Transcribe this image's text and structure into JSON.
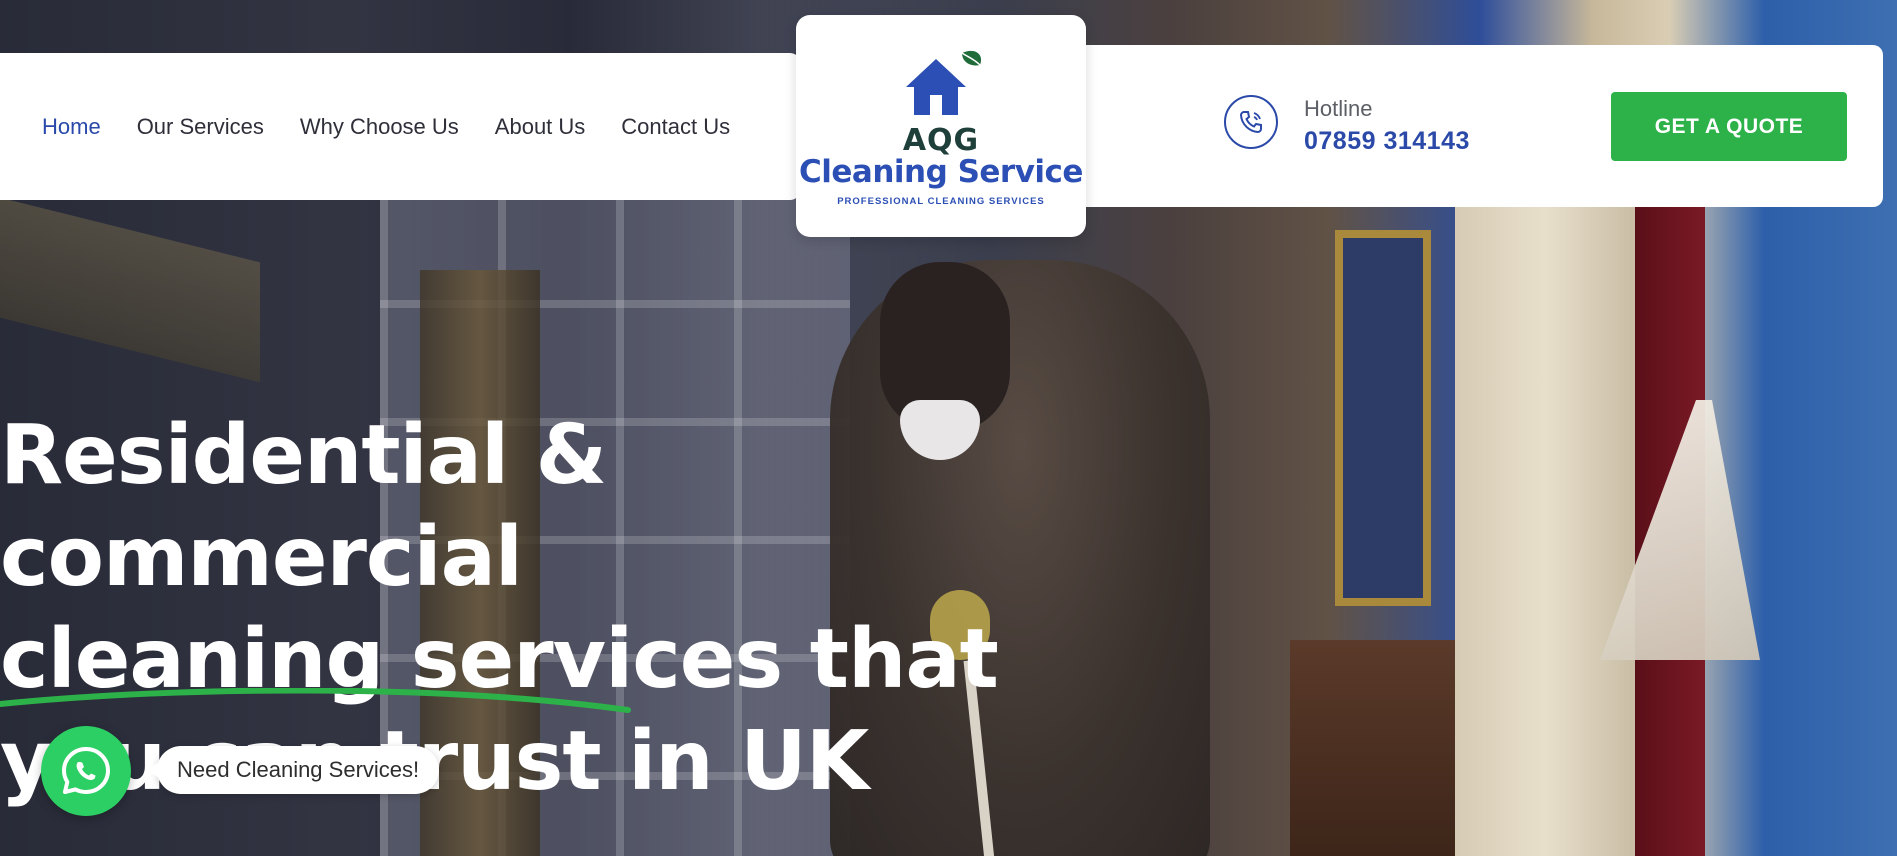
{
  "nav": {
    "items": [
      {
        "label": "Home",
        "active": true
      },
      {
        "label": "Our Services",
        "active": false
      },
      {
        "label": "Why Choose Us",
        "active": false
      },
      {
        "label": "About Us",
        "active": false
      },
      {
        "label": "Contact Us",
        "active": false
      }
    ]
  },
  "logo": {
    "abbr": "AQG",
    "name": "Cleaning Service",
    "tagline": "PROFESSIONAL CLEANING SERVICES",
    "icon": "house-leaf-icon"
  },
  "contact": {
    "hotline_label": "Hotline",
    "hotline_number": "07859 314143",
    "icon": "phone-icon"
  },
  "cta": {
    "quote_label": "GET A QUOTE"
  },
  "hero": {
    "headline_lines": [
      "Residential &",
      "commercial",
      "cleaning services that",
      "you can trust in UK"
    ]
  },
  "whatsapp": {
    "message": "Need Cleaning Services!",
    "icon": "whatsapp-icon"
  },
  "colors": {
    "brand_blue": "#2a49a8",
    "brand_green": "#2db24a",
    "whatsapp_green": "#2ccf63"
  }
}
